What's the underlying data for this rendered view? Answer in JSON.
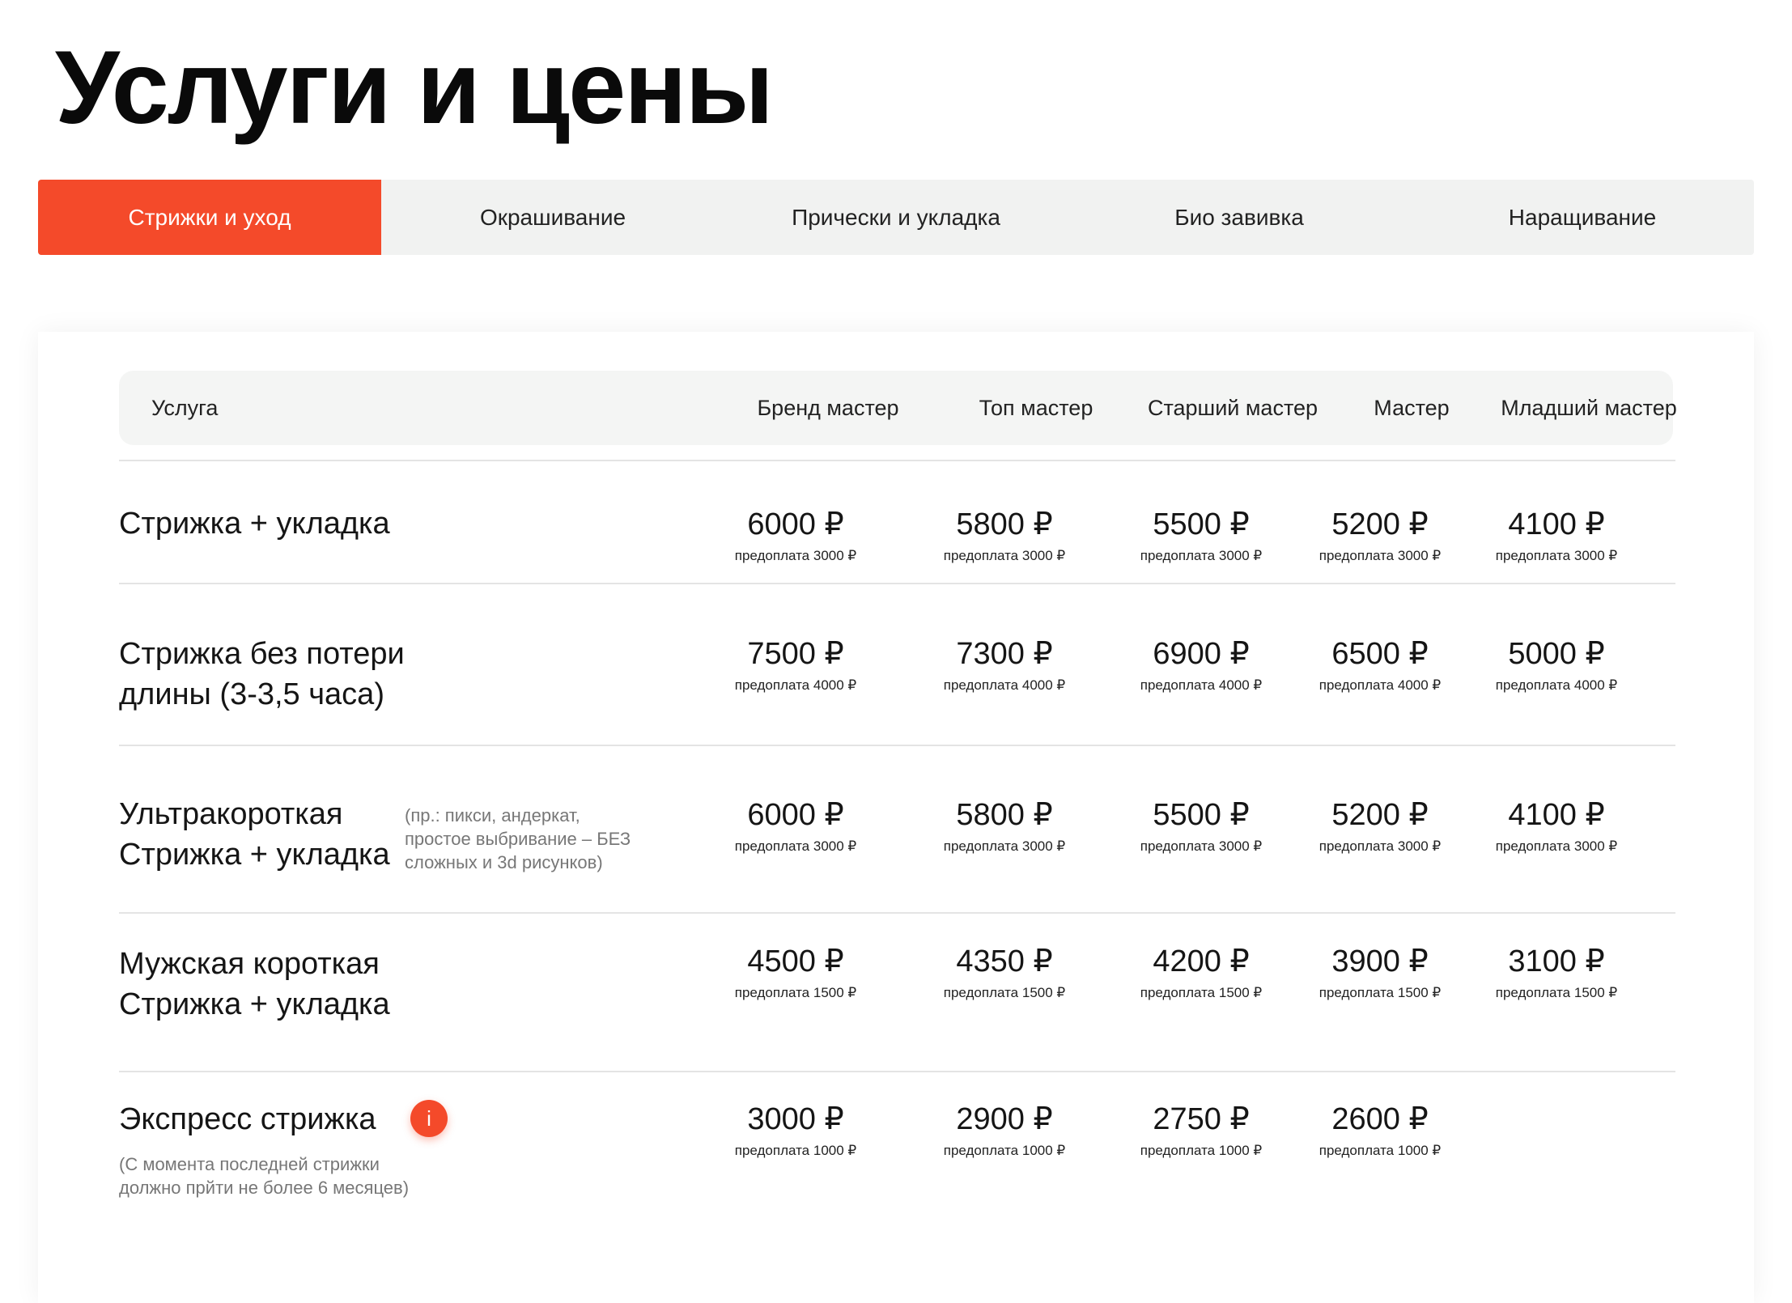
{
  "page": {
    "title": "Услуги и цены"
  },
  "tabs": [
    {
      "label": "Стрижки и уход",
      "active": true
    },
    {
      "label": "Окрашивание"
    },
    {
      "label": "Прически и укладка"
    },
    {
      "label": "Био завивка"
    },
    {
      "label": "Наращивание"
    }
  ],
  "table": {
    "headers": {
      "service": "Услуга",
      "cols": [
        "Бренд мастер",
        "Топ мастер",
        "Старший мастер",
        "Мастер",
        "Младший мастер"
      ]
    },
    "rows": [
      {
        "name_lines": [
          "Стрижка + укладка"
        ],
        "prices": [
          {
            "amount": "6000 ₽",
            "prepay": "предоплата 3000 ₽"
          },
          {
            "amount": "5800 ₽",
            "prepay": "предоплата 3000 ₽"
          },
          {
            "amount": "5500 ₽",
            "prepay": "предоплата 3000 ₽"
          },
          {
            "amount": "5200 ₽",
            "prepay": "предоплата 3000 ₽"
          },
          {
            "amount": "4100 ₽",
            "prepay": "предоплата 3000 ₽"
          }
        ]
      },
      {
        "name_lines": [
          "Стрижка без потери",
          "длины (3-3,5 часа)"
        ],
        "prices": [
          {
            "amount": "7500 ₽",
            "prepay": "предоплата 4000 ₽"
          },
          {
            "amount": "7300 ₽",
            "prepay": "предоплата 4000 ₽"
          },
          {
            "amount": "6900 ₽",
            "prepay": "предоплата 4000 ₽"
          },
          {
            "amount": "6500 ₽",
            "prepay": "предоплата 4000 ₽"
          },
          {
            "amount": "5000 ₽",
            "prepay": "предоплата 4000 ₽"
          }
        ]
      },
      {
        "name_lines": [
          "Ультракороткая",
          "Стрижка + укладка"
        ],
        "note_lines": [
          "(пр.: пикси, андеркат,",
          "простое выбривание – БЕЗ",
          "сложных и 3d рисунков)"
        ],
        "prices": [
          {
            "amount": "6000 ₽",
            "prepay": "предоплата 3000 ₽"
          },
          {
            "amount": "5800 ₽",
            "prepay": "предоплата 3000 ₽"
          },
          {
            "amount": "5500 ₽",
            "prepay": "предоплата 3000 ₽"
          },
          {
            "amount": "5200 ₽",
            "prepay": "предоплата 3000 ₽"
          },
          {
            "amount": "4100 ₽",
            "prepay": "предоплата 3000 ₽"
          }
        ]
      },
      {
        "name_lines": [
          "Мужская короткая",
          "Стрижка + укладка"
        ],
        "prices": [
          {
            "amount": "4500 ₽",
            "prepay": "предоплата 1500 ₽"
          },
          {
            "amount": "4350 ₽",
            "prepay": "предоплата 1500 ₽"
          },
          {
            "amount": "4200 ₽",
            "prepay": "предоплата 1500 ₽"
          },
          {
            "amount": "3900 ₽",
            "prepay": "предоплата 1500 ₽"
          },
          {
            "amount": "3100 ₽",
            "prepay": "предоплата 1500 ₽"
          }
        ]
      },
      {
        "name_lines": [
          "Экспресс стрижка"
        ],
        "note_lines": [
          "(С момента последней стрижки",
          "должно прйти не более 6 месяцев)"
        ],
        "info_icon": "info-icon",
        "info_symbol": "i",
        "prices": [
          {
            "amount": "3000 ₽",
            "prepay": "предоплата 1000 ₽"
          },
          {
            "amount": "2900 ₽",
            "prepay": "предоплата 1000 ₽"
          },
          {
            "amount": "2750 ₽",
            "prepay": "предоплата 1000 ₽"
          },
          {
            "amount": "2600 ₽",
            "prepay": "предоплата 1000 ₽"
          }
        ]
      }
    ]
  },
  "colors": {
    "accent": "#f44a2a",
    "tabs_bg": "#f1f2f1",
    "header_bg": "#f4f5f4"
  }
}
